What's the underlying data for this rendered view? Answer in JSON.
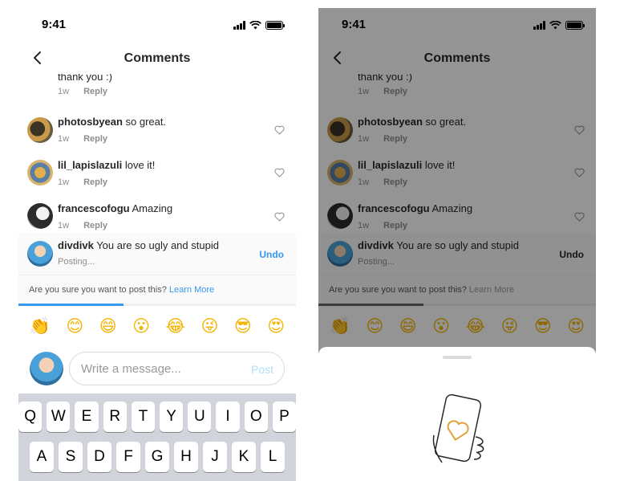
{
  "status": {
    "time": "9:41"
  },
  "nav": {
    "title": "Comments"
  },
  "comments": [
    {
      "username": "",
      "text": "thank you :)",
      "age": "1w",
      "reply": "Reply"
    },
    {
      "username": "photosbyean",
      "text": "so great.",
      "age": "1w",
      "reply": "Reply"
    },
    {
      "username": "lil_lapislazuli",
      "text": "love it!",
      "age": "1w",
      "reply": "Reply"
    },
    {
      "username": "francescofogu",
      "text": "Amazing",
      "age": "1w",
      "reply": "Reply"
    }
  ],
  "pending_comment": {
    "username": "divdivk",
    "text": "You are so ugly and stupid",
    "status": "Posting...",
    "undo": "Undo"
  },
  "confirmation": {
    "question": "Are you sure you want to post this?",
    "link": "Learn More"
  },
  "posting_progress": 0.38,
  "emoji_bar": [
    "👏",
    "😊",
    "😄",
    "😮",
    "😂",
    "😜",
    "😎",
    "😍"
  ],
  "compose": {
    "placeholder": "Write a message...",
    "post_label": "Post"
  },
  "keyboard": {
    "row1": [
      "Q",
      "W",
      "E",
      "R",
      "T",
      "Y",
      "U",
      "I",
      "O",
      "P"
    ],
    "row2": [
      "A",
      "S",
      "D",
      "F",
      "G",
      "H",
      "J",
      "K",
      "L"
    ]
  },
  "colors": {
    "accent": "#3897f0",
    "meta_grey": "#8e8e8e",
    "overlay": "#000000",
    "keyboard_bg": "#d1d5db"
  },
  "icons": [
    "back-chevron-icon",
    "heart-outline-icon",
    "signal-icon",
    "wifi-icon",
    "battery-icon",
    "phone-heart-illustration"
  ]
}
